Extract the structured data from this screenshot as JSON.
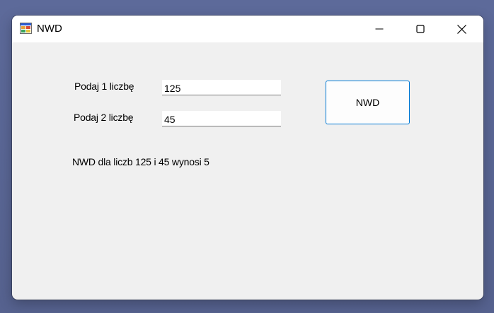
{
  "window": {
    "title": "NWD",
    "icon": "windows-forms-app-icon"
  },
  "titlebar_buttons": {
    "minimize_icon": "minimize-icon",
    "maximize_icon": "maximize-icon",
    "close_icon": "close-icon"
  },
  "form": {
    "label1": "Podaj 1 liczbę",
    "input1_value": "125",
    "label2": "Podaj 2 liczbę",
    "input2_value": "45",
    "button_label": "NWD",
    "result": "NWD dla liczb 125 i 45 wynosi 5"
  },
  "colors": {
    "accent_border": "#0078d4",
    "window_bg": "#f0f0f0",
    "desktop_bg": "#5d6a9a"
  }
}
